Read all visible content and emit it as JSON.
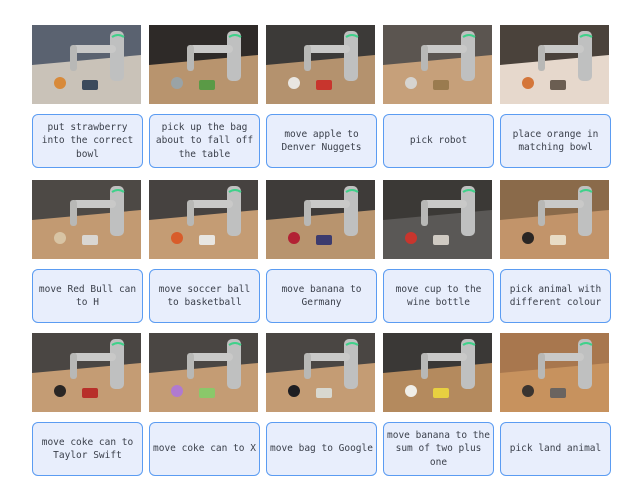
{
  "figure": {
    "rows": [
      {
        "items": [
          {
            "instruction": "put strawberry into the correct bowl",
            "image": "robot arm at kitchen counter with fruit bowl and fridge",
            "palette": [
              "#5a6270",
              "#c9c2b8",
              "#d88a3a",
              "#3b4a5c"
            ]
          },
          {
            "instruction": "pick up the bag about to fall off the table",
            "image": "robot arm grabbing chip bag at table edge",
            "palette": [
              "#2e2a28",
              "#b8946e",
              "#9aa3a6",
              "#5a9a46"
            ]
          },
          {
            "instruction": "move apple to Denver Nuggets",
            "image": "robot arm moving red apple onto logo cards",
            "palette": [
              "#3c3a38",
              "#b4926e",
              "#e9e6e1",
              "#c8352d"
            ]
          },
          {
            "instruction": "pick robot",
            "image": "robot arm above toy robot figures on table",
            "palette": [
              "#5b5550",
              "#c6a07a",
              "#d6d4d0",
              "#9a7b4f"
            ]
          },
          {
            "instruction": "place orange in matching bowl",
            "image": "two bowls with oranges on dark table",
            "palette": [
              "#4a423b",
              "#e6d8cc",
              "#d4763a",
              "#6b5e52"
            ]
          }
        ]
      },
      {
        "items": [
          {
            "instruction": "move Red Bull can to H",
            "image": "robot arm with can above wooden letter blocks",
            "palette": [
              "#4d4945",
              "#c29a72",
              "#d8c4a4",
              "#d9d6d2"
            ]
          },
          {
            "instruction": "move soccer ball to basketball",
            "image": "robot arm with soccer ball and basketball on table",
            "palette": [
              "#464240",
              "#c49c74",
              "#d85c2a",
              "#e8e6e2"
            ]
          },
          {
            "instruction": "move banana to Germany",
            "image": "robot arm placing banana near printed flags",
            "palette": [
              "#3e3b39",
              "#b8946e",
              "#b22234",
              "#3c3b6e"
            ]
          },
          {
            "instruction": "move cup to the wine bottle",
            "image": "robot arm on dark table with cup, apple and wine bottle",
            "palette": [
              "#3b3936",
              "#5a5856",
              "#c8352d",
              "#cfcac2"
            ]
          },
          {
            "instruction": "pick animal with different colour",
            "image": "robot gripper over toy animals on wooden table",
            "palette": [
              "#8a6a4a",
              "#c2946a",
              "#2a2624",
              "#e8dcc6"
            ]
          }
        ]
      },
      {
        "items": [
          {
            "instruction": "move coke can to Taylor Swift",
            "image": "robot arm holding coke can over picture frames",
            "palette": [
              "#4a4643",
              "#c49c74",
              "#2a2624",
              "#b8302a"
            ]
          },
          {
            "instruction": "move coke can to X",
            "image": "robot arm holding coke can over colorful letter shapes",
            "palette": [
              "#4a4643",
              "#c49c74",
              "#b07ad0",
              "#8ac86a"
            ]
          },
          {
            "instruction": "move bag to Google",
            "image": "robot arm near black bag and printed logo",
            "palette": [
              "#4a4643",
              "#c49c74",
              "#1e1e22",
              "#d8d8d0"
            ]
          },
          {
            "instruction": "move banana to the sum of two plus one",
            "image": "robot arm with banana over numbered papers",
            "palette": [
              "#3a3836",
              "#b48a5e",
              "#f0eee8",
              "#e8d040"
            ]
          },
          {
            "instruction": "pick land animal",
            "image": "robot gripper over toy octopus and horse on table",
            "palette": [
              "#a8774e",
              "#c7925e",
              "#3a3430",
              "#6a6460"
            ]
          }
        ]
      }
    ]
  },
  "colors": {
    "label_border": "#5b9cf2",
    "label_background": "#e8eefc",
    "label_text": "#3a3f4a",
    "page_background": "#ffffff"
  }
}
